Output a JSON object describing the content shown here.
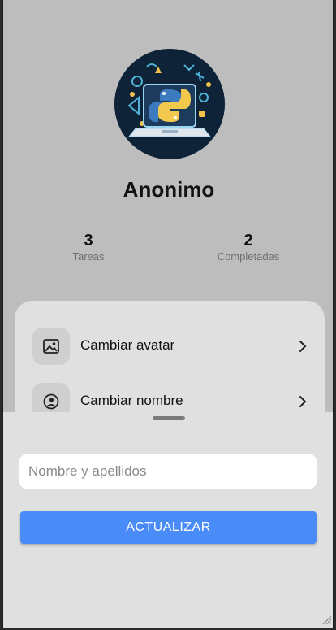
{
  "profile": {
    "avatar_icon": "python-laptop-avatar-icon",
    "username": "Anonimo"
  },
  "stats": [
    {
      "value": "3",
      "label": "Tareas"
    },
    {
      "value": "2",
      "label": "Completadas"
    }
  ],
  "menu": {
    "items": [
      {
        "label": "Cambiar avatar",
        "icon": "image-icon"
      },
      {
        "label": "Cambiar nombre",
        "icon": "user-circle-icon"
      }
    ]
  },
  "sheet": {
    "name_placeholder": "Nombre y apellidos",
    "name_value": "",
    "update_label": "ACTUALIZAR"
  },
  "colors": {
    "background": "#bdbdbd",
    "card": "#e0e0e0",
    "accent": "#4a8cf7"
  }
}
